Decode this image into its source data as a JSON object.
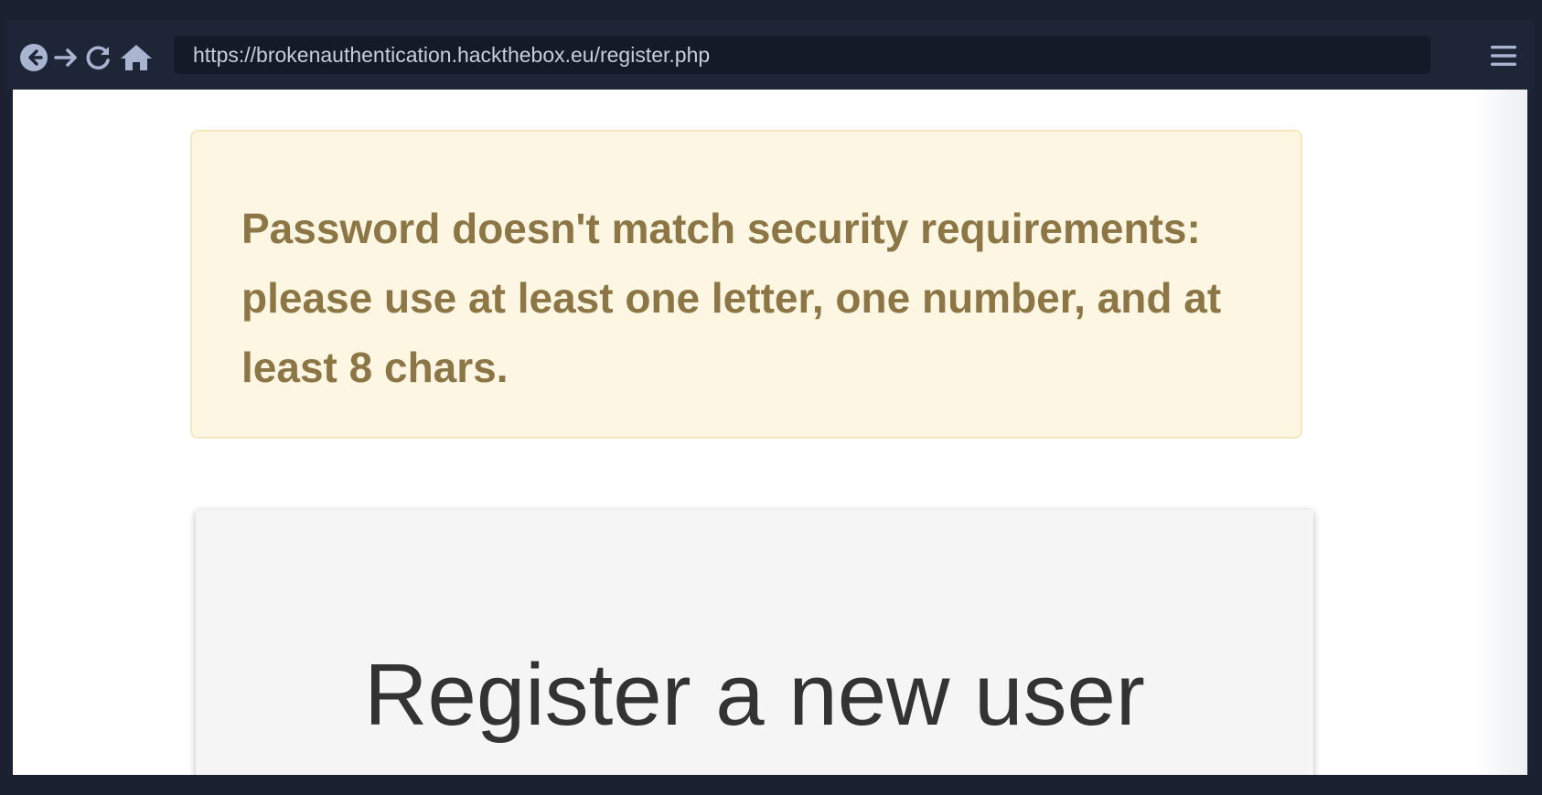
{
  "browser": {
    "url": "https://brokenauthentication.hackthebox.eu/register.php",
    "icons": {
      "back": "back-arrow-circle-icon",
      "forward": "forward-arrow-icon",
      "reload": "reload-icon",
      "home": "home-icon",
      "menu": "hamburger-menu-icon"
    },
    "icon_color": "#a9b4d0"
  },
  "page": {
    "alert": {
      "message": "Password doesn't match security requirements: please use at least one letter, one number, and at least 8 chars.",
      "background": "#fcf6e3",
      "text_color": "#8c7646"
    },
    "card": {
      "title": "Register a new user"
    }
  }
}
